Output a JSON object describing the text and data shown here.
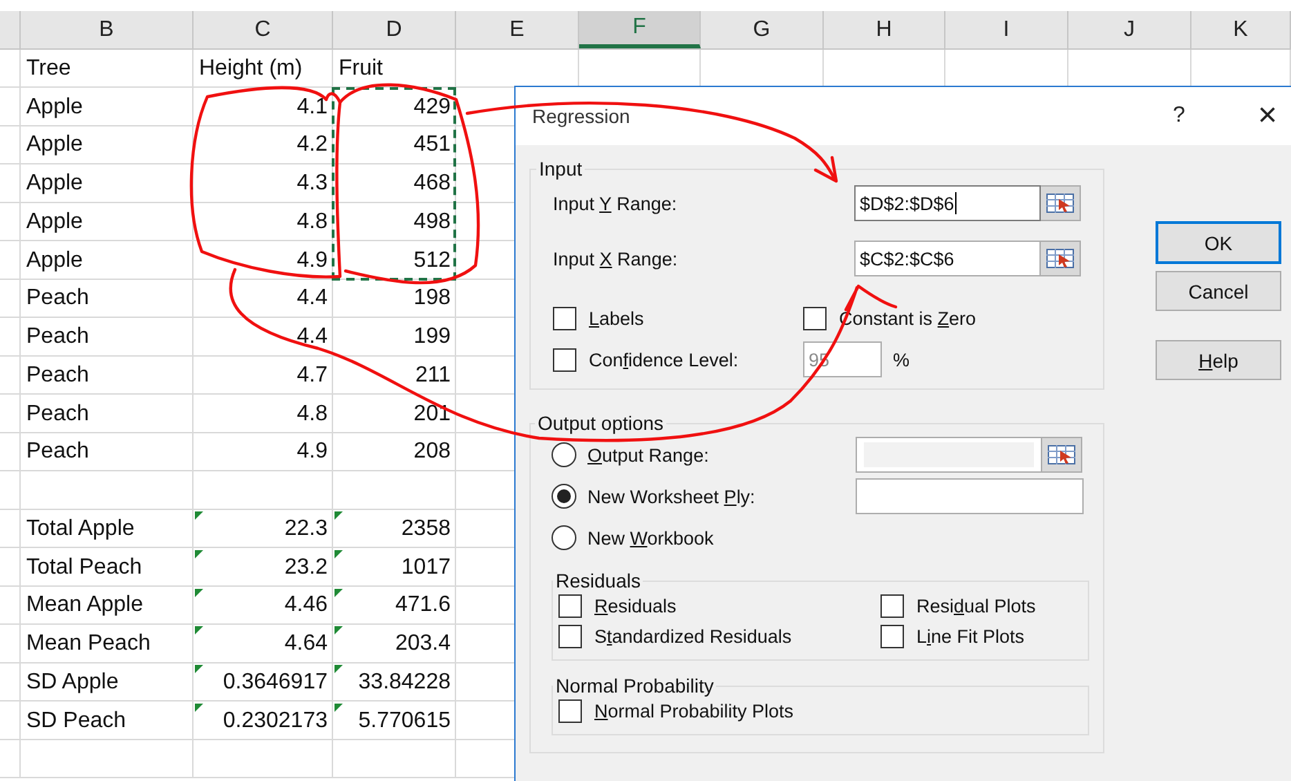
{
  "sheet": {
    "columns": [
      {
        "label": "B",
        "selected": false
      },
      {
        "label": "C",
        "selected": false
      },
      {
        "label": "D",
        "selected": false
      },
      {
        "label": "E",
        "selected": false
      },
      {
        "label": "F",
        "selected": true
      },
      {
        "label": "G",
        "selected": false
      },
      {
        "label": "H",
        "selected": false
      },
      {
        "label": "I",
        "selected": false
      },
      {
        "label": "J",
        "selected": false
      },
      {
        "label": "K",
        "selected": false
      }
    ],
    "rows": [
      {
        "kind": "data",
        "cells": [
          {
            "kind": "text",
            "text": "Tree",
            "copied": false,
            "flagged": false
          },
          {
            "kind": "text",
            "text": "Height (m)",
            "copied": false,
            "flagged": false
          },
          {
            "kind": "text",
            "text": "Fruit",
            "copied": false,
            "flagged": false
          }
        ]
      },
      {
        "kind": "data",
        "cells": [
          {
            "kind": "text",
            "text": "Apple",
            "copied": false,
            "flagged": false
          },
          {
            "kind": "number",
            "text": "4.1",
            "copied": false,
            "flagged": false
          },
          {
            "kind": "number",
            "text": "429",
            "copied": true,
            "flagged": false
          }
        ]
      },
      {
        "kind": "data",
        "cells": [
          {
            "kind": "text",
            "text": "Apple",
            "copied": false,
            "flagged": false
          },
          {
            "kind": "number",
            "text": "4.2",
            "copied": false,
            "flagged": false
          },
          {
            "kind": "number",
            "text": "451",
            "copied": true,
            "flagged": false
          }
        ]
      },
      {
        "kind": "data",
        "cells": [
          {
            "kind": "text",
            "text": "Apple",
            "copied": false,
            "flagged": false
          },
          {
            "kind": "number",
            "text": "4.3",
            "copied": false,
            "flagged": false
          },
          {
            "kind": "number",
            "text": "468",
            "copied": true,
            "flagged": false
          }
        ]
      },
      {
        "kind": "data",
        "cells": [
          {
            "kind": "text",
            "text": "Apple",
            "copied": false,
            "flagged": false
          },
          {
            "kind": "number",
            "text": "4.8",
            "copied": false,
            "flagged": false
          },
          {
            "kind": "number",
            "text": "498",
            "copied": true,
            "flagged": false
          }
        ]
      },
      {
        "kind": "data",
        "cells": [
          {
            "kind": "text",
            "text": "Apple",
            "copied": false,
            "flagged": false
          },
          {
            "kind": "number",
            "text": "4.9",
            "copied": false,
            "flagged": false
          },
          {
            "kind": "number",
            "text": "512",
            "copied": true,
            "flagged": false
          }
        ]
      },
      {
        "kind": "data",
        "cells": [
          {
            "kind": "text",
            "text": "Peach",
            "copied": false,
            "flagged": false
          },
          {
            "kind": "number",
            "text": "4.4",
            "copied": false,
            "flagged": false
          },
          {
            "kind": "number",
            "text": "198",
            "copied": false,
            "flagged": false
          }
        ]
      },
      {
        "kind": "data",
        "cells": [
          {
            "kind": "text",
            "text": "Peach",
            "copied": false,
            "flagged": false
          },
          {
            "kind": "number",
            "text": "4.4",
            "copied": false,
            "flagged": false
          },
          {
            "kind": "number",
            "text": "199",
            "copied": false,
            "flagged": false
          }
        ]
      },
      {
        "kind": "data",
        "cells": [
          {
            "kind": "text",
            "text": "Peach",
            "copied": false,
            "flagged": false
          },
          {
            "kind": "number",
            "text": "4.7",
            "copied": false,
            "flagged": false
          },
          {
            "kind": "number",
            "text": "211",
            "copied": false,
            "flagged": false
          }
        ]
      },
      {
        "kind": "data",
        "cells": [
          {
            "kind": "text",
            "text": "Peach",
            "copied": false,
            "flagged": false
          },
          {
            "kind": "number",
            "text": "4.8",
            "copied": false,
            "flagged": false
          },
          {
            "kind": "number",
            "text": "201",
            "copied": false,
            "flagged": false
          }
        ]
      },
      {
        "kind": "data",
        "cells": [
          {
            "kind": "text",
            "text": "Peach",
            "copied": false,
            "flagged": false
          },
          {
            "kind": "number",
            "text": "4.9",
            "copied": false,
            "flagged": false
          },
          {
            "kind": "number",
            "text": "208",
            "copied": false,
            "flagged": false
          }
        ]
      },
      {
        "kind": "blank"
      },
      {
        "kind": "data",
        "cells": [
          {
            "kind": "text",
            "text": "Total Apple",
            "copied": false,
            "flagged": false
          },
          {
            "kind": "number",
            "text": "22.3",
            "copied": false,
            "flagged": true
          },
          {
            "kind": "number",
            "text": "2358",
            "copied": false,
            "flagged": true
          }
        ]
      },
      {
        "kind": "data",
        "cells": [
          {
            "kind": "text",
            "text": "Total Peach",
            "copied": false,
            "flagged": false
          },
          {
            "kind": "number",
            "text": "23.2",
            "copied": false,
            "flagged": true
          },
          {
            "kind": "number",
            "text": "1017",
            "copied": false,
            "flagged": true
          }
        ]
      },
      {
        "kind": "data",
        "cells": [
          {
            "kind": "text",
            "text": "Mean Apple",
            "copied": false,
            "flagged": false
          },
          {
            "kind": "number",
            "text": "4.46",
            "copied": false,
            "flagged": true
          },
          {
            "kind": "number",
            "text": "471.6",
            "copied": false,
            "flagged": true
          }
        ]
      },
      {
        "kind": "data",
        "cells": [
          {
            "kind": "text",
            "text": "Mean Peach",
            "copied": false,
            "flagged": false
          },
          {
            "kind": "number",
            "text": "4.64",
            "copied": false,
            "flagged": true
          },
          {
            "kind": "number",
            "text": "203.4",
            "copied": false,
            "flagged": true
          }
        ]
      },
      {
        "kind": "data",
        "cells": [
          {
            "kind": "text",
            "text": "SD Apple",
            "copied": false,
            "flagged": false
          },
          {
            "kind": "number",
            "text": "0.3646917",
            "copied": false,
            "flagged": true
          },
          {
            "kind": "number",
            "text": "33.84228",
            "copied": false,
            "flagged": true
          }
        ]
      },
      {
        "kind": "data",
        "cells": [
          {
            "kind": "text",
            "text": "SD Peach",
            "copied": false,
            "flagged": false
          },
          {
            "kind": "number",
            "text": "0.2302173",
            "copied": false,
            "flagged": true
          },
          {
            "kind": "number",
            "text": "5.770615",
            "copied": false,
            "flagged": true
          }
        ]
      },
      {
        "kind": "blank"
      }
    ]
  },
  "dialog": {
    "title": "Regression",
    "help": "?",
    "close": "×",
    "input": {
      "title": "Input",
      "ranges": [
        {
          "label": {
            "pre": "Input ",
            "key": "Y",
            "post": " Range:"
          },
          "value": "$D$2:$D$6",
          "focused": true
        },
        {
          "label": {
            "pre": "Input ",
            "key": "X",
            "post": " Range:"
          },
          "value": "$C$2:$C$6",
          "focused": false
        }
      ],
      "options": [
        {
          "kind": "checkbox",
          "label": {
            "key": "L",
            "post": "abels"
          },
          "checked": false
        },
        {
          "kind": "checkbox",
          "label": {
            "pre": "Constant is ",
            "key": "Z",
            "post": "ero"
          },
          "checked": false
        },
        {
          "kind": "level",
          "label": {
            "pre": "Con",
            "key": "f",
            "post": "idence Level:"
          },
          "checked": false,
          "value": "95",
          "unit": "%",
          "disabled": true
        }
      ]
    },
    "buttons": [
      {
        "label": {
          "pre": "OK"
        },
        "default": true
      },
      {
        "label": {
          "pre": "Cancel"
        },
        "default": false
      },
      {
        "label": {
          "key": "H",
          "post": "elp"
        },
        "default": false
      }
    ],
    "output": {
      "title": "Output options",
      "destinations": [
        {
          "label": {
            "key": "O",
            "post": "utput Range:"
          },
          "selected": false,
          "field": {
            "disabled": true,
            "picker": true
          }
        },
        {
          "label": {
            "pre": "New Worksheet ",
            "key": "P",
            "post": "ly:"
          },
          "selected": true,
          "field": {
            "disabled": false,
            "picker": false
          }
        },
        {
          "label": {
            "pre": "New ",
            "key": "W",
            "post": "orkbook"
          },
          "selected": false
        }
      ],
      "residuals": {
        "title": "Residuals",
        "checks": [
          {
            "label": {
              "key": "R",
              "post": "esiduals"
            },
            "checked": false
          },
          {
            "label": {
              "pre": "Resi",
              "key": "d",
              "post": "ual Plots"
            },
            "checked": false
          },
          {
            "label": {
              "pre": "S",
              "key": "t",
              "post": "andardized Residuals"
            },
            "checked": false
          },
          {
            "label": {
              "pre": "L",
              "key": "i",
              "post": "ne Fit Plots"
            },
            "checked": false
          }
        ]
      },
      "normal": {
        "title": "Normal Probability",
        "checks": [
          {
            "label": {
              "key": "N",
              "post": "ormal Probability Plots"
            },
            "checked": false
          }
        ]
      }
    }
  }
}
